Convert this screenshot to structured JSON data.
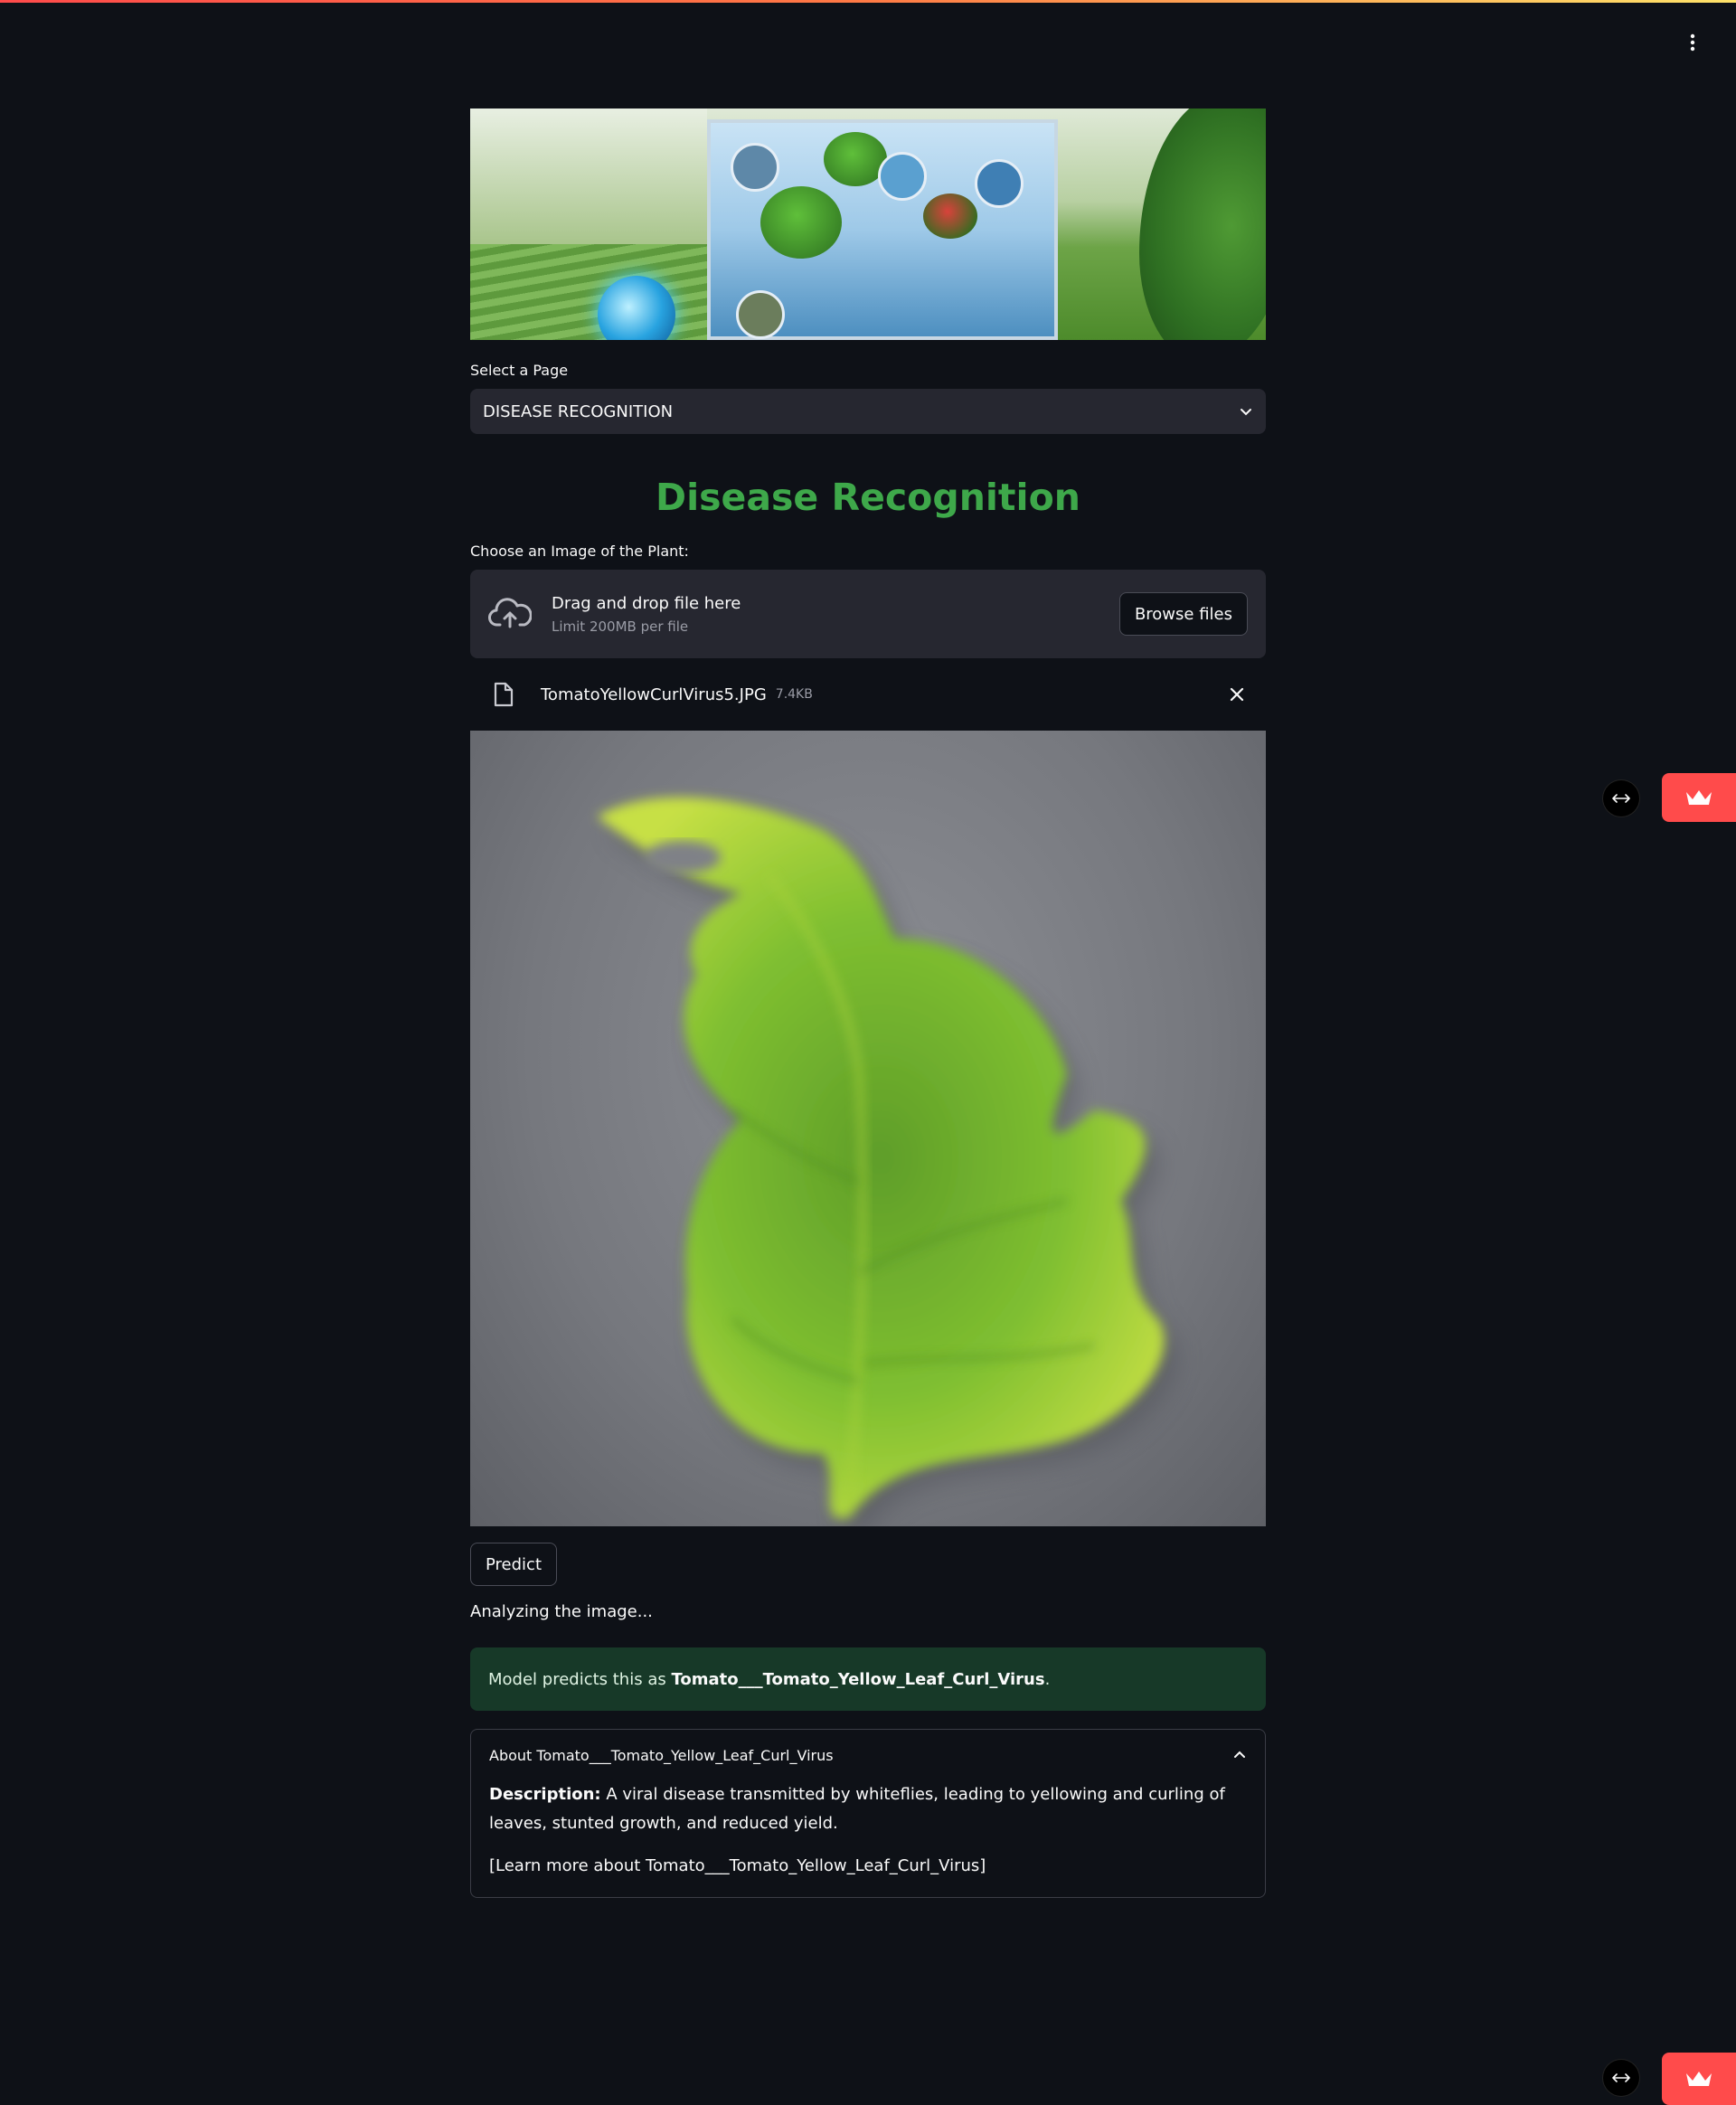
{
  "menu": {
    "icon": "kebab-menu-icon"
  },
  "page_select": {
    "label": "Select a Page",
    "value": "DISEASE RECOGNITION"
  },
  "heading": "Disease Recognition",
  "uploader": {
    "label": "Choose an Image of the Plant:",
    "drop_text": "Drag and drop file here",
    "limit_text": "Limit 200MB per file",
    "browse_label": "Browse files"
  },
  "file": {
    "name": "TomatoYellowCurlVirus5.JPG",
    "size": "7.4KB"
  },
  "predict_label": "Predict",
  "status_text": "Analyzing the image...",
  "result": {
    "prefix": "Model predicts this as ",
    "class_name": "Tomato___Tomato_Yellow_Leaf_Curl_Virus",
    "suffix": "."
  },
  "expander": {
    "title": "About Tomato___Tomato_Yellow_Leaf_Curl_Virus",
    "desc_label": "Description:",
    "desc_text": " A viral disease transmitted by whiteflies, leading to yellowing and curling of leaves, stunted growth, and reduced yield.",
    "link_text": "[Learn more about Tomato___Tomato_Yellow_Leaf_Curl_Virus]"
  },
  "colors": {
    "background": "#0e1117",
    "heading": "#3ea84a",
    "success_bg": "#173928",
    "accent_red": "#ff4b4b"
  }
}
